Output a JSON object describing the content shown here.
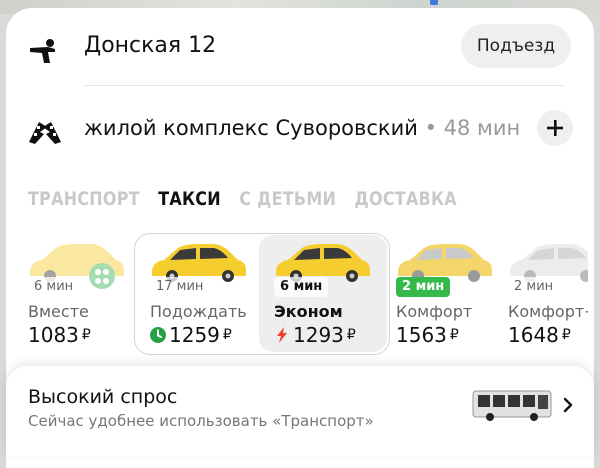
{
  "route": {
    "from_address": "Донская 12",
    "entrance_label": "Подъезд",
    "to_address": "жилой комплекс Суворовский",
    "to_eta": " • 48 мин"
  },
  "tabs": [
    {
      "label": "ТРАНСПОРТ",
      "active": false
    },
    {
      "label": "ТАКСИ",
      "active": true
    },
    {
      "label": "С ДЕТЬМИ",
      "active": false
    },
    {
      "label": "ДОСТАВКА",
      "active": false
    }
  ],
  "tariffs": [
    {
      "time": "6 мин",
      "name": "Вместе",
      "price": "1083",
      "currency": "₽"
    },
    {
      "time": "17 мин",
      "name": "Подождать",
      "price": "1259",
      "currency": "₽"
    },
    {
      "time": "6 мин",
      "name": "Эконом",
      "price": "1293",
      "currency": "₽",
      "selected": true
    },
    {
      "time": "2 мин",
      "name": "Комфорт",
      "price": "1563",
      "currency": "₽"
    },
    {
      "time": "2 мин",
      "name": "Комфорт+",
      "price": "1648",
      "currency": "₽"
    }
  ],
  "demand": {
    "title": "Высокий спрос",
    "subtitle": "Сейчас удобнее использовать «Транспорт»"
  },
  "colors": {
    "taxi_yellow": "#f6cd2e",
    "wait_green": "#26a043",
    "surge_red": "#f04030",
    "time_green": "#35b94a"
  }
}
